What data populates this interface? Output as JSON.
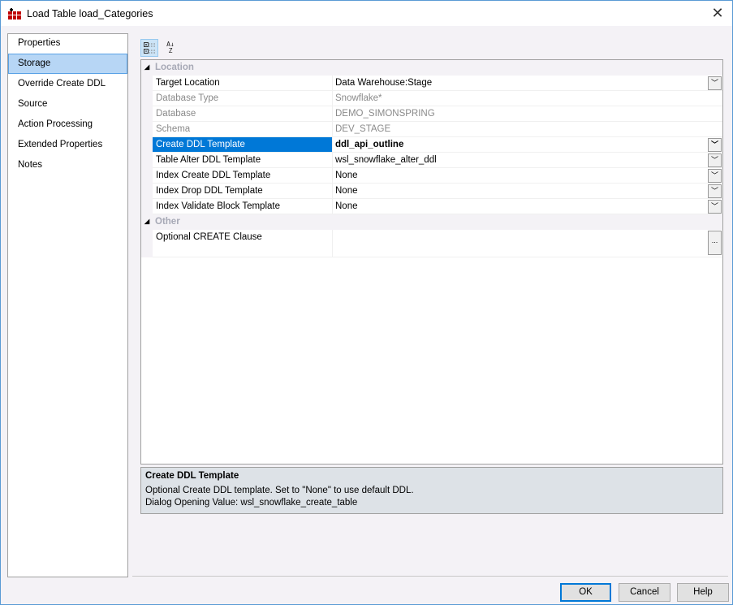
{
  "window": {
    "title": "Load Table load_Categories"
  },
  "nav": [
    "Properties",
    "Storage",
    "Override Create DDL",
    "Source",
    "Action Processing",
    "Extended Properties",
    "Notes"
  ],
  "nav_selected": "Storage",
  "grid": {
    "categories": {
      "location": "Location",
      "other": "Other"
    },
    "location_rows": [
      {
        "label": "Target Location",
        "value": "Data Warehouse:Stage",
        "readonly": false,
        "dropdown": true
      },
      {
        "label": "Database Type",
        "value": "Snowflake*",
        "readonly": true,
        "dropdown": false
      },
      {
        "label": "Database",
        "value": "DEMO_SIMONSPRING",
        "readonly": true,
        "dropdown": false
      },
      {
        "label": "Schema",
        "value": "DEV_STAGE",
        "readonly": true,
        "dropdown": false
      },
      {
        "label": "Create DDL Template",
        "value": "ddl_api_outline",
        "readonly": false,
        "dropdown": true,
        "selected": true,
        "bold": true
      },
      {
        "label": "Table Alter DDL Template",
        "value": "wsl_snowflake_alter_ddl",
        "readonly": false,
        "dropdown": true
      },
      {
        "label": "Index Create DDL Template",
        "value": "None",
        "readonly": false,
        "dropdown": true
      },
      {
        "label": "Index Drop DDL Template",
        "value": "None",
        "readonly": false,
        "dropdown": true
      },
      {
        "label": "Index Validate Block Template",
        "value": "None",
        "readonly": false,
        "dropdown": true
      }
    ],
    "other_rows": [
      {
        "label": "Optional CREATE Clause",
        "value": "",
        "ellipsis": "..."
      }
    ]
  },
  "description": {
    "title": "Create DDL Template",
    "line1": "Optional Create DDL template. Set to \"None\" to use default DDL.",
    "line2": "Dialog Opening Value: wsl_snowflake_create_table"
  },
  "buttons": {
    "ok": "OK",
    "cancel": "Cancel",
    "help": "Help"
  },
  "toolbar": {
    "sort_alpha": "A↓Z"
  }
}
